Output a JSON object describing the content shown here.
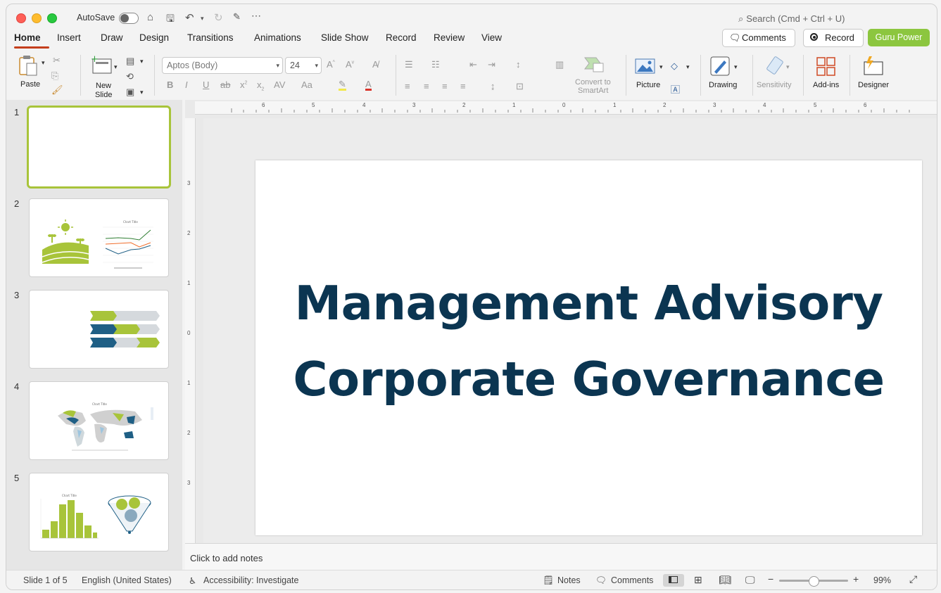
{
  "titlebar": {
    "autosave_label": "AutoSave",
    "search_placeholder": "Search (Cmd + Ctrl + U)"
  },
  "tabs": [
    "Home",
    "Insert",
    "Draw",
    "Design",
    "Transitions",
    "Animations",
    "Slide Show",
    "Record",
    "Review",
    "View"
  ],
  "header_buttons": {
    "comments": "Comments",
    "record": "Record",
    "guru": "Guru Power"
  },
  "ribbon": {
    "paste": "Paste",
    "new_slide_1": "New",
    "new_slide_2": "Slide",
    "font_name": "Aptos (Body)",
    "font_size": "24",
    "convert_1": "Convert to",
    "convert_2": "SmartArt",
    "picture": "Picture",
    "drawing": "Drawing",
    "sensitivity": "Sensitivity",
    "addins": "Add-ins",
    "designer": "Designer"
  },
  "ruler": {
    "h_ticks": [
      "6",
      "5",
      "4",
      "3",
      "2",
      "1",
      "0",
      "1",
      "2",
      "3",
      "4",
      "5",
      "6"
    ],
    "v_ticks": [
      "3",
      "2",
      "1",
      "0",
      "1",
      "2",
      "3"
    ]
  },
  "thumbnails": {
    "numbers": [
      "1",
      "2",
      "3",
      "4",
      "5"
    ],
    "chart_title": "Chart Title"
  },
  "slide": {
    "line1": "Management Advisory",
    "line2": "Corporate Governance"
  },
  "notes": {
    "placeholder": "Click to add notes"
  },
  "status": {
    "slide_info": "Slide 1 of 5",
    "language": "English (United States)",
    "accessibility": "Accessibility: Investigate",
    "notes": "Notes",
    "comments": "Comments",
    "zoom": "99%"
  },
  "colors": {
    "accent_green": "#8cc63f",
    "title_navy": "#0b3551",
    "tab_underline": "#c43e1c",
    "thumb_green": "#a8c43a",
    "thumb_blue": "#1f5f85",
    "thumb_gray": "#d5d9dd"
  }
}
